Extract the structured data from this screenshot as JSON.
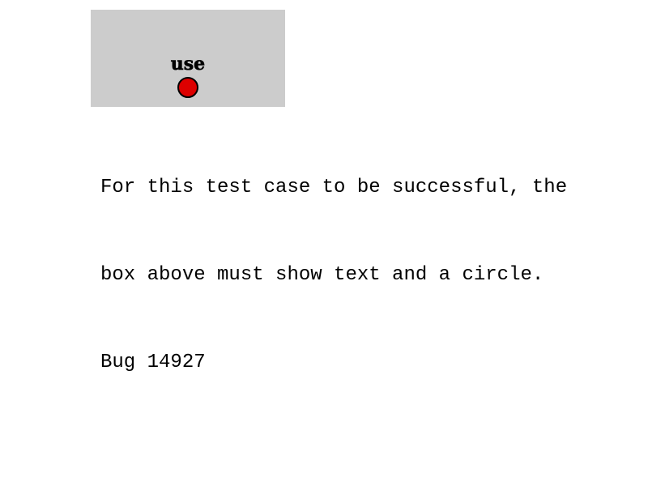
{
  "test_box": {
    "label": "use",
    "circle_color": "#dd0000",
    "background_color": "#cccccc"
  },
  "description": {
    "lines": [
      "For this test case to be successful, the",
      "box above must show text and a circle.",
      "Bug 14927"
    ]
  }
}
